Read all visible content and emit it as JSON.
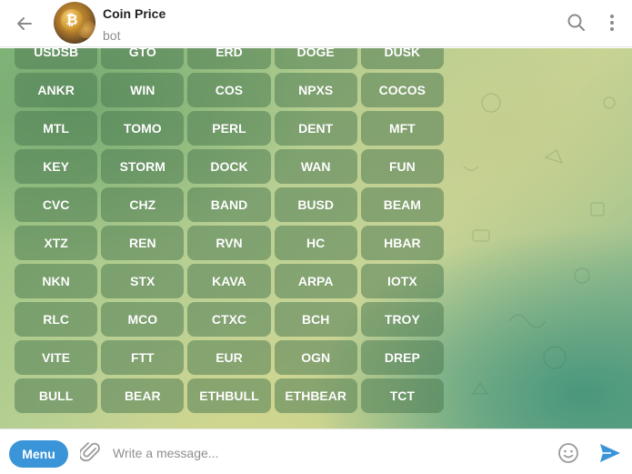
{
  "header": {
    "title": "Coin Price",
    "subtitle": "bot",
    "avatar_glyph": "₿"
  },
  "icons": {
    "back": "back-arrow-icon",
    "search": "search-icon",
    "more": "more-vertical-icon",
    "attach": "paperclip-icon",
    "emoji": "emoji-icon",
    "send": "send-icon"
  },
  "colors": {
    "accent": "#3a95d8",
    "key_button": "#4a7850"
  },
  "keyboard": {
    "rows": [
      [
        "USDSB",
        "GTO",
        "ERD",
        "DOGE",
        "DUSK"
      ],
      [
        "ANKR",
        "WIN",
        "COS",
        "NPXS",
        "COCOS"
      ],
      [
        "MTL",
        "TOMO",
        "PERL",
        "DENT",
        "MFT"
      ],
      [
        "KEY",
        "STORM",
        "DOCK",
        "WAN",
        "FUN"
      ],
      [
        "CVC",
        "CHZ",
        "BAND",
        "BUSD",
        "BEAM"
      ],
      [
        "XTZ",
        "REN",
        "RVN",
        "HC",
        "HBAR"
      ],
      [
        "NKN",
        "STX",
        "KAVA",
        "ARPA",
        "IOTX"
      ],
      [
        "RLC",
        "MCO",
        "CTXC",
        "BCH",
        "TROY"
      ],
      [
        "VITE",
        "FTT",
        "EUR",
        "OGN",
        "DREP"
      ],
      [
        "BULL",
        "BEAR",
        "ETHBULL",
        "ETHBEAR",
        "TCT"
      ]
    ]
  },
  "composer": {
    "menu_label": "Menu",
    "placeholder": "Write a message..."
  }
}
